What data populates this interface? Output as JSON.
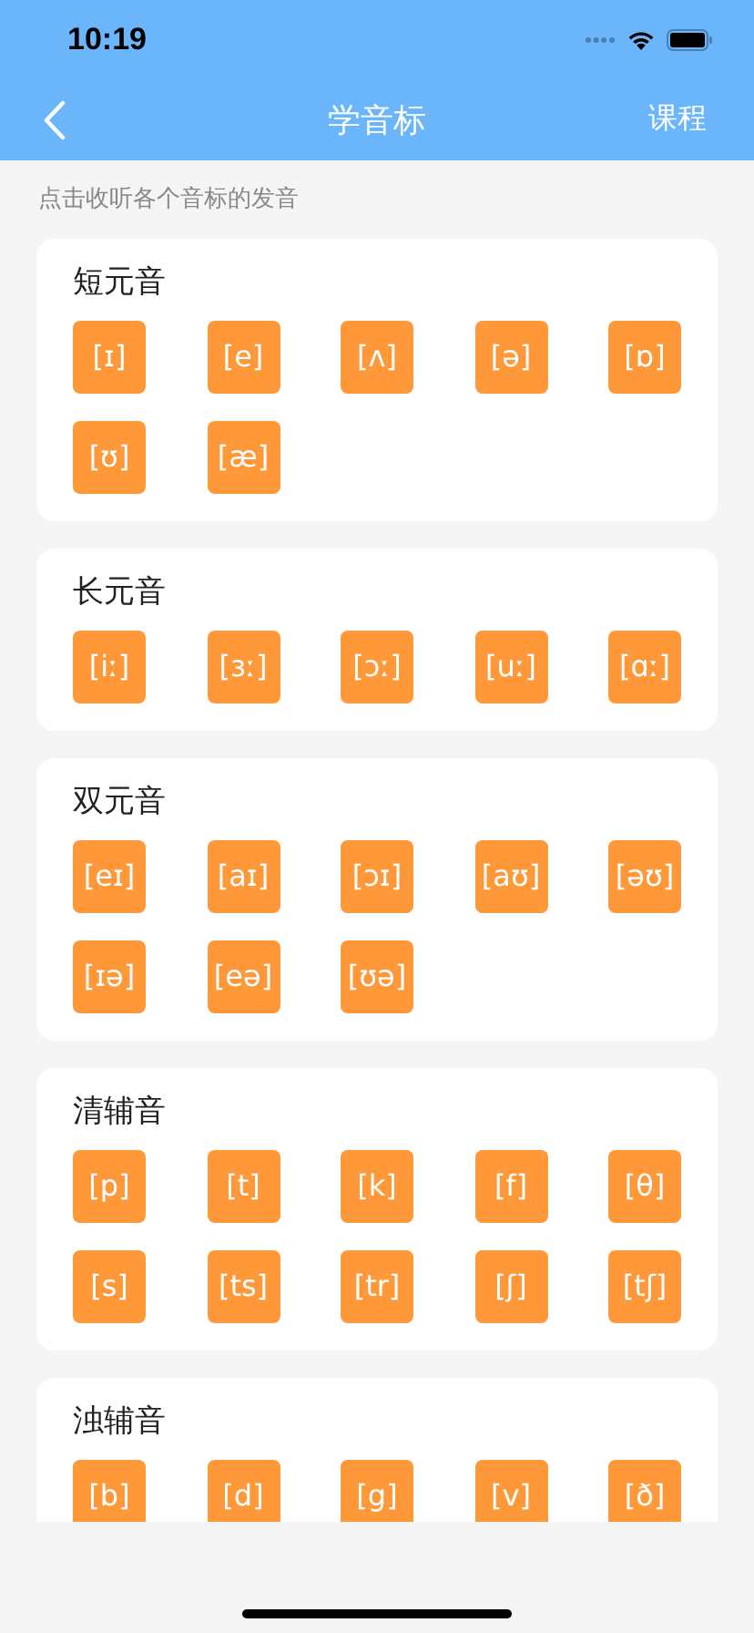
{
  "status_bar": {
    "time": "10:19"
  },
  "nav": {
    "title": "学音标",
    "action": "课程"
  },
  "hint": "点击收听各个音标的发音",
  "sections": [
    {
      "title": "短元音",
      "symbols": [
        "[ɪ]",
        "[e]",
        "[ʌ]",
        "[ə]",
        "[ɒ]",
        "[ʊ]",
        "[æ]"
      ]
    },
    {
      "title": "长元音",
      "symbols": [
        "[iː]",
        "[ɜː]",
        "[ɔː]",
        "[uː]",
        "[ɑː]"
      ]
    },
    {
      "title": "双元音",
      "symbols": [
        "[eɪ]",
        "[aɪ]",
        "[ɔɪ]",
        "[aʊ]",
        "[əʊ]",
        "[ɪə]",
        "[eə]",
        "[ʊə]"
      ]
    },
    {
      "title": "清辅音",
      "symbols": [
        "[p]",
        "[t]",
        "[k]",
        "[f]",
        "[θ]",
        "[s]",
        "[ts]",
        "[tr]",
        "[ʃ]",
        "[tʃ]"
      ]
    },
    {
      "title": "浊辅音",
      "symbols": [
        "[b]",
        "[d]",
        "[g]",
        "[v]",
        "[ð]"
      ]
    }
  ]
}
